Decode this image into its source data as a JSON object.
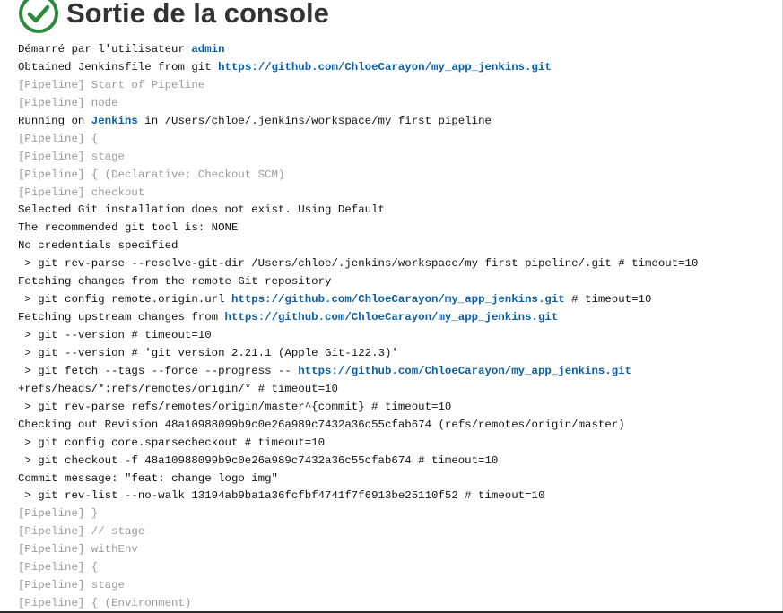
{
  "header": {
    "title": "Sortie de la console",
    "status_icon": "check-circle-icon",
    "status_color": "#2b8a3e"
  },
  "colors": {
    "link": "#0b5fa5",
    "muted": "#9a9a9a",
    "text": "#111111"
  },
  "console": {
    "lines": [
      {
        "kind": "normal",
        "parts": [
          {
            "t": "Démarré par l'utilisateur "
          },
          {
            "t": "admin",
            "link": true
          }
        ]
      },
      {
        "kind": "normal",
        "parts": [
          {
            "t": "Obtained Jenkinsfile from git "
          },
          {
            "t": "https://github.com/ChloeCarayon/my_app_jenkins.git",
            "link": true
          }
        ]
      },
      {
        "kind": "muted",
        "parts": [
          {
            "t": "[Pipeline] Start of Pipeline"
          }
        ]
      },
      {
        "kind": "muted",
        "parts": [
          {
            "t": "[Pipeline] node"
          }
        ]
      },
      {
        "kind": "normal",
        "parts": [
          {
            "t": "Running on "
          },
          {
            "t": "Jenkins",
            "link": true
          },
          {
            "t": " in /Users/chloe/.jenkins/workspace/my first pipeline"
          }
        ]
      },
      {
        "kind": "muted",
        "parts": [
          {
            "t": "[Pipeline] {"
          }
        ]
      },
      {
        "kind": "muted",
        "parts": [
          {
            "t": "[Pipeline] stage"
          }
        ]
      },
      {
        "kind": "muted",
        "parts": [
          {
            "t": "[Pipeline] { (Declarative: Checkout SCM)"
          }
        ]
      },
      {
        "kind": "muted",
        "parts": [
          {
            "t": "[Pipeline] checkout"
          }
        ]
      },
      {
        "kind": "normal",
        "parts": [
          {
            "t": "Selected Git installation does not exist. Using Default"
          }
        ]
      },
      {
        "kind": "normal",
        "parts": [
          {
            "t": "The recommended git tool is: NONE"
          }
        ]
      },
      {
        "kind": "normal",
        "parts": [
          {
            "t": "No credentials specified"
          }
        ]
      },
      {
        "kind": "normal",
        "parts": [
          {
            "t": " > git rev-parse --resolve-git-dir /Users/chloe/.jenkins/workspace/my first pipeline/.git # timeout=10"
          }
        ]
      },
      {
        "kind": "normal",
        "parts": [
          {
            "t": "Fetching changes from the remote Git repository"
          }
        ]
      },
      {
        "kind": "normal",
        "parts": [
          {
            "t": " > git config remote.origin.url "
          },
          {
            "t": "https://github.com/ChloeCarayon/my_app_jenkins.git",
            "link": true
          },
          {
            "t": " # timeout=10"
          }
        ]
      },
      {
        "kind": "normal",
        "parts": [
          {
            "t": "Fetching upstream changes from "
          },
          {
            "t": "https://github.com/ChloeCarayon/my_app_jenkins.git",
            "link": true
          }
        ]
      },
      {
        "kind": "normal",
        "parts": [
          {
            "t": " > git --version # timeout=10"
          }
        ]
      },
      {
        "kind": "normal",
        "parts": [
          {
            "t": " > git --version # 'git version 2.21.1 (Apple Git-122.3)'"
          }
        ]
      },
      {
        "kind": "normal",
        "parts": [
          {
            "t": " > git fetch --tags --force --progress -- "
          },
          {
            "t": "https://github.com/ChloeCarayon/my_app_jenkins.git",
            "link": true
          }
        ]
      },
      {
        "kind": "normal",
        "parts": [
          {
            "t": "+refs/heads/*:refs/remotes/origin/* # timeout=10"
          }
        ]
      },
      {
        "kind": "normal",
        "parts": [
          {
            "t": " > git rev-parse refs/remotes/origin/master^{commit} # timeout=10"
          }
        ]
      },
      {
        "kind": "normal",
        "parts": [
          {
            "t": "Checking out Revision 48a10988099b9c0e26a989c7432a36c55cfab674 (refs/remotes/origin/master)"
          }
        ]
      },
      {
        "kind": "normal",
        "parts": [
          {
            "t": " > git config core.sparsecheckout # timeout=10"
          }
        ]
      },
      {
        "kind": "normal",
        "parts": [
          {
            "t": " > git checkout -f 48a10988099b9c0e26a989c7432a36c55cfab674 # timeout=10"
          }
        ]
      },
      {
        "kind": "normal",
        "parts": [
          {
            "t": "Commit message: \"feat: change logo img\""
          }
        ]
      },
      {
        "kind": "normal",
        "parts": [
          {
            "t": " > git rev-list --no-walk 13194ab9ba1a36fcfbf4741f7f6913be25110f52 # timeout=10"
          }
        ]
      },
      {
        "kind": "muted",
        "parts": [
          {
            "t": "[Pipeline] }"
          }
        ]
      },
      {
        "kind": "muted",
        "parts": [
          {
            "t": "[Pipeline] // stage"
          }
        ]
      },
      {
        "kind": "muted",
        "parts": [
          {
            "t": "[Pipeline] withEnv"
          }
        ]
      },
      {
        "kind": "muted",
        "parts": [
          {
            "t": "[Pipeline] {"
          }
        ]
      },
      {
        "kind": "muted",
        "parts": [
          {
            "t": "[Pipeline] stage"
          }
        ]
      },
      {
        "kind": "muted",
        "parts": [
          {
            "t": "[Pipeline] { (Environment)"
          }
        ]
      }
    ]
  }
}
